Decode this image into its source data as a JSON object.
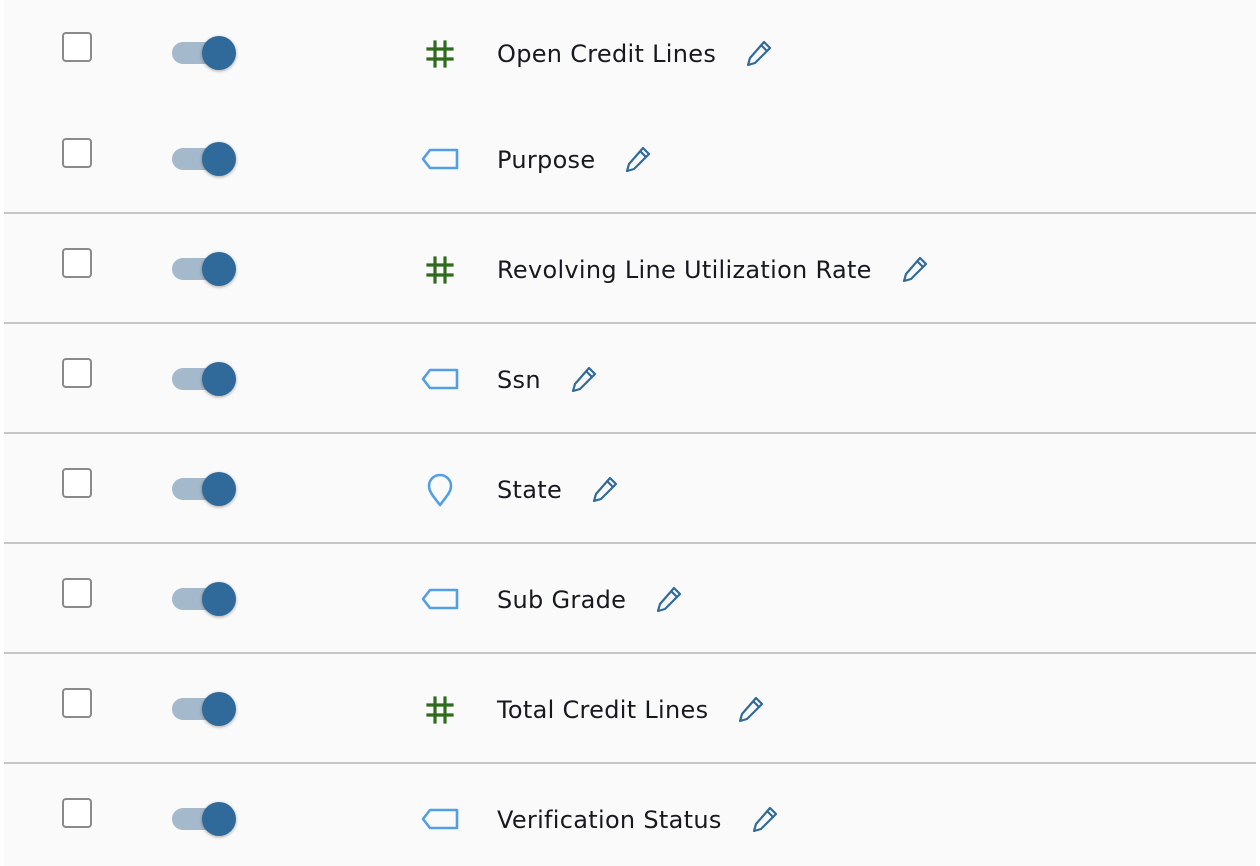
{
  "colors": {
    "row_background": "#fafafa",
    "divider": "#c6c6c6",
    "toggle_track": "#a5b9cc",
    "toggle_thumb": "#2f6a9a",
    "numeric_icon": "#2e6b1d",
    "string_icon": "#539fe5",
    "pencil": "#2f6a9a"
  },
  "fields": [
    {
      "label": "Open Credit Lines",
      "type_icon": "hash-icon",
      "selected": false,
      "enabled": true
    },
    {
      "label": "Purpose",
      "type_icon": "tag-icon",
      "selected": false,
      "enabled": true
    },
    {
      "label": "Revolving Line Utilization Rate",
      "type_icon": "hash-icon",
      "selected": false,
      "enabled": true
    },
    {
      "label": "Ssn",
      "type_icon": "tag-icon",
      "selected": false,
      "enabled": true
    },
    {
      "label": "State",
      "type_icon": "map-pin-icon",
      "selected": false,
      "enabled": true
    },
    {
      "label": "Sub Grade",
      "type_icon": "tag-icon",
      "selected": false,
      "enabled": true
    },
    {
      "label": "Total Credit Lines",
      "type_icon": "hash-icon",
      "selected": false,
      "enabled": true
    },
    {
      "label": "Verification Status",
      "type_icon": "tag-icon",
      "selected": false,
      "enabled": true
    }
  ]
}
